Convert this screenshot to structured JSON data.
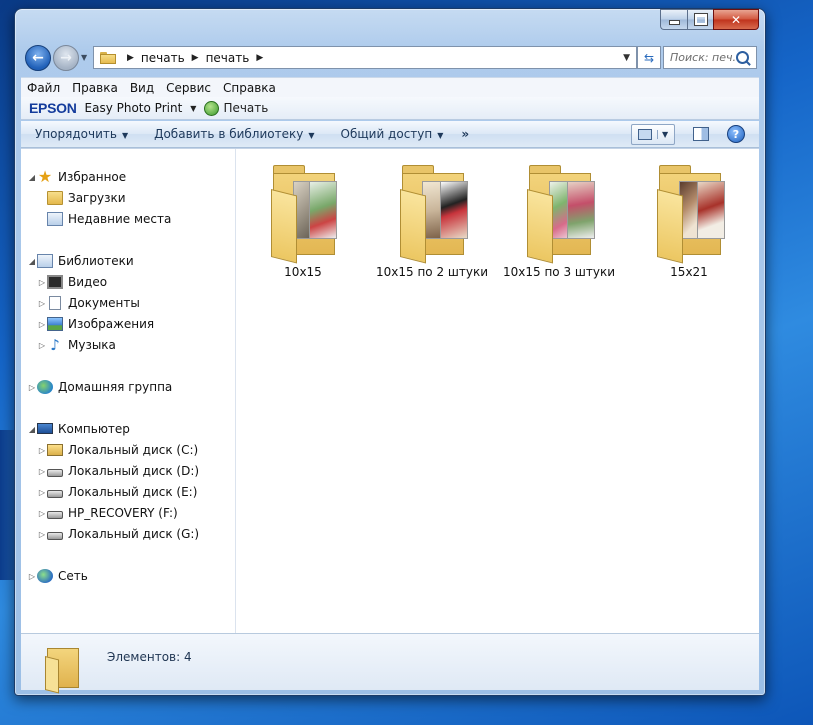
{
  "colors": {
    "window_frame": "#aecbec",
    "desktop": "#1565c8",
    "accent": "#1e395b",
    "epson_brand": "#143c9c"
  },
  "window": {
    "caption_buttons": [
      "minimize-icon",
      "maximize-icon",
      "close-icon"
    ],
    "close_glyph": "✕"
  },
  "address_bar": {
    "breadcrumbs": [
      "печать",
      "печать"
    ],
    "search_placeholder": "Поиск: печ..."
  },
  "menu": {
    "items": [
      "Файл",
      "Правка",
      "Вид",
      "Сервис",
      "Справка"
    ]
  },
  "epson_bar": {
    "brand": "EPSON",
    "app": "Easy Photo Print",
    "print_label": "Печать"
  },
  "command_bar": {
    "organize": "Упорядочить",
    "add_to_library": "Добавить в библиотеку",
    "share": "Общий доступ",
    "more": "»"
  },
  "nav_pane": {
    "favorites": {
      "label": "Избранное",
      "items": [
        "Загрузки",
        "Недавние места"
      ]
    },
    "libraries": {
      "label": "Библиотеки",
      "items": [
        "Видео",
        "Документы",
        "Изображения",
        "Музыка"
      ]
    },
    "homegroup": {
      "label": "Домашняя группа"
    },
    "computer": {
      "label": "Компьютер",
      "items": [
        "Локальный диск (C:)",
        "Локальный диск (D:)",
        "Локальный диск (E:)",
        "HP_RECOVERY (F:)",
        "Локальный диск (G:)"
      ]
    },
    "network": {
      "label": "Сеть"
    }
  },
  "folders": [
    {
      "name": "10x15"
    },
    {
      "name": "10x15 по 2 штуки"
    },
    {
      "name": "10x15 по 3 штуки"
    },
    {
      "name": "15x21"
    }
  ],
  "status_bar": {
    "count_text": "Элементов: 4"
  }
}
